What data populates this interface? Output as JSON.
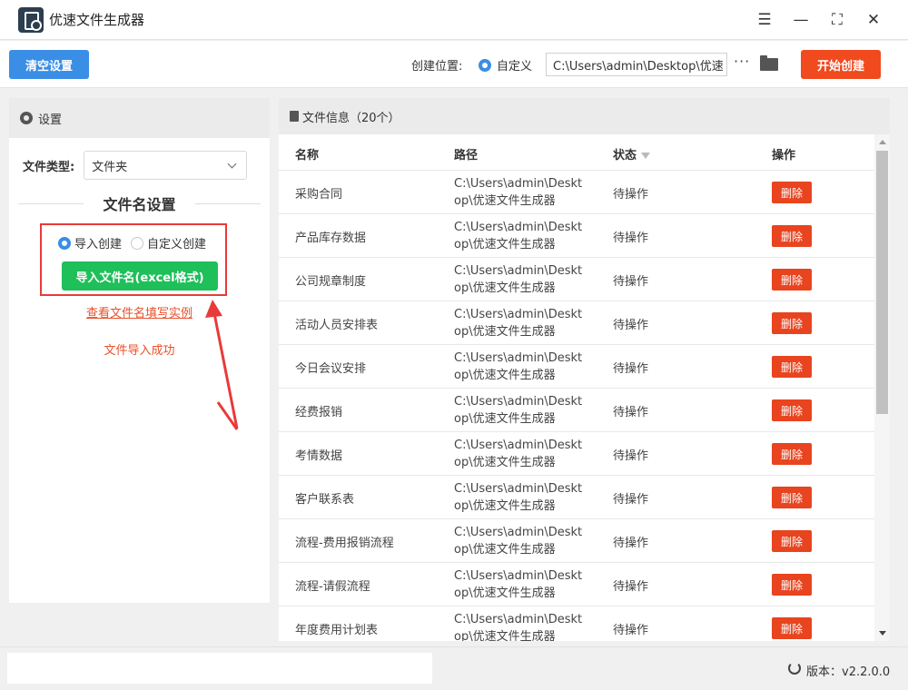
{
  "app": {
    "title": "优速文件生成器"
  },
  "window_controls": {
    "menu": "☰",
    "minimize": "—",
    "maximize": "⛶",
    "close": "✕"
  },
  "toolbar": {
    "clear_label": "清空设置",
    "location_label": "创建位置:",
    "custom_label": "自定义",
    "path_value": "C:\\Users\\admin\\Desktop\\优速",
    "more_label": "···",
    "start_label": "开始创建"
  },
  "settings": {
    "header": "设置",
    "file_type_label": "文件类型:",
    "file_type_value": "文件夹",
    "section_title": "文件名设置",
    "mode_import": "导入创建",
    "mode_custom": "自定义创建",
    "import_button": "导入文件名(excel格式)",
    "example_link": "查看文件名填写实例",
    "success_text": "文件导入成功"
  },
  "files": {
    "header": "文件信息（20个）",
    "columns": {
      "name": "名称",
      "path": "路径",
      "status": "状态",
      "action": "操作"
    },
    "rows": [
      {
        "name": "采购合同",
        "path": "C:\\Users\\admin\\Desktop\\优速文件生成器",
        "status": "待操作",
        "action": "删除"
      },
      {
        "name": "产品库存数据",
        "path": "C:\\Users\\admin\\Desktop\\优速文件生成器",
        "status": "待操作",
        "action": "删除"
      },
      {
        "name": "公司规章制度",
        "path": "C:\\Users\\admin\\Desktop\\优速文件生成器",
        "status": "待操作",
        "action": "删除"
      },
      {
        "name": "活动人员安排表",
        "path": "C:\\Users\\admin\\Desktop\\优速文件生成器",
        "status": "待操作",
        "action": "删除"
      },
      {
        "name": "今日会议安排",
        "path": "C:\\Users\\admin\\Desktop\\优速文件生成器",
        "status": "待操作",
        "action": "删除"
      },
      {
        "name": "经费报销",
        "path": "C:\\Users\\admin\\Desktop\\优速文件生成器",
        "status": "待操作",
        "action": "删除"
      },
      {
        "name": "考情数据",
        "path": "C:\\Users\\admin\\Desktop\\优速文件生成器",
        "status": "待操作",
        "action": "删除"
      },
      {
        "name": "客户联系表",
        "path": "C:\\Users\\admin\\Desktop\\优速文件生成器",
        "status": "待操作",
        "action": "删除"
      },
      {
        "name": "流程-费用报销流程",
        "path": "C:\\Users\\admin\\Desktop\\优速文件生成器",
        "status": "待操作",
        "action": "删除"
      },
      {
        "name": "流程-请假流程",
        "path": "C:\\Users\\admin\\Desktop\\优速文件生成器",
        "status": "待操作",
        "action": "删除"
      },
      {
        "name": "年度费用计划表",
        "path": "C:\\Users\\admin\\Desktop\\优速文件生成器",
        "status": "待操作",
        "action": "删除"
      }
    ]
  },
  "statusbar": {
    "version": "版本：v2.2.0.0"
  },
  "colors": {
    "primary": "#3a8ee6",
    "danger": "#f04a1e",
    "success": "#1fbf5a",
    "annotation": "#e83a3a"
  }
}
